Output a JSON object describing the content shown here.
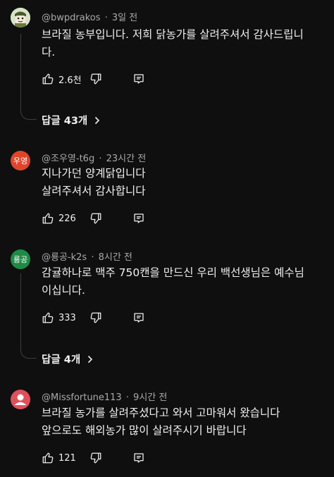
{
  "comments": [
    {
      "avatar_type": "cartoon-face",
      "author": "@bwpdrakos",
      "time": "3일 전",
      "lines": [
        "브라질 농부입니다. 저희 닭농가를 살려주셔서 감사드립니",
        "다."
      ],
      "likes": "2.6천",
      "replies_label": "답글 43개"
    },
    {
      "avatar_text": "우영",
      "avatar_color": "#e0452b",
      "author": "@조우영-t6g",
      "time": "23시간 전",
      "lines": [
        "지나가던 양계닭입니다",
        "살려주셔서 감사합니다"
      ],
      "likes": "226"
    },
    {
      "avatar_text": "룡공",
      "avatar_color": "#1f8a46",
      "author": "@룡공-k2s",
      "time": "8시간 전",
      "lines": [
        "감귤하나로 맥주 750캔을 만드신 우리 백선생님은 예수님",
        "이십니다."
      ],
      "likes": "333",
      "replies_label": "답글 4개"
    },
    {
      "avatar_type": "default-user",
      "avatar_color": "#e0505c",
      "author": "@Missfortune113",
      "time": "9시간 전",
      "lines": [
        "브라질 농가를 살려주셨다고 와서 고마워서 왔습니다",
        "앞으로도 해외농가 많이 살려주시기 바랍니다"
      ],
      "likes": "121"
    }
  ],
  "icons": {
    "like": "thumbs-up-icon",
    "dislike": "thumbs-down-icon",
    "reply": "reply-comment-icon",
    "chevron": "chevron-right-icon"
  },
  "colors": {
    "background": "#0f0f0f",
    "text": "#f1f1f1",
    "meta": "#aaaaaa"
  }
}
